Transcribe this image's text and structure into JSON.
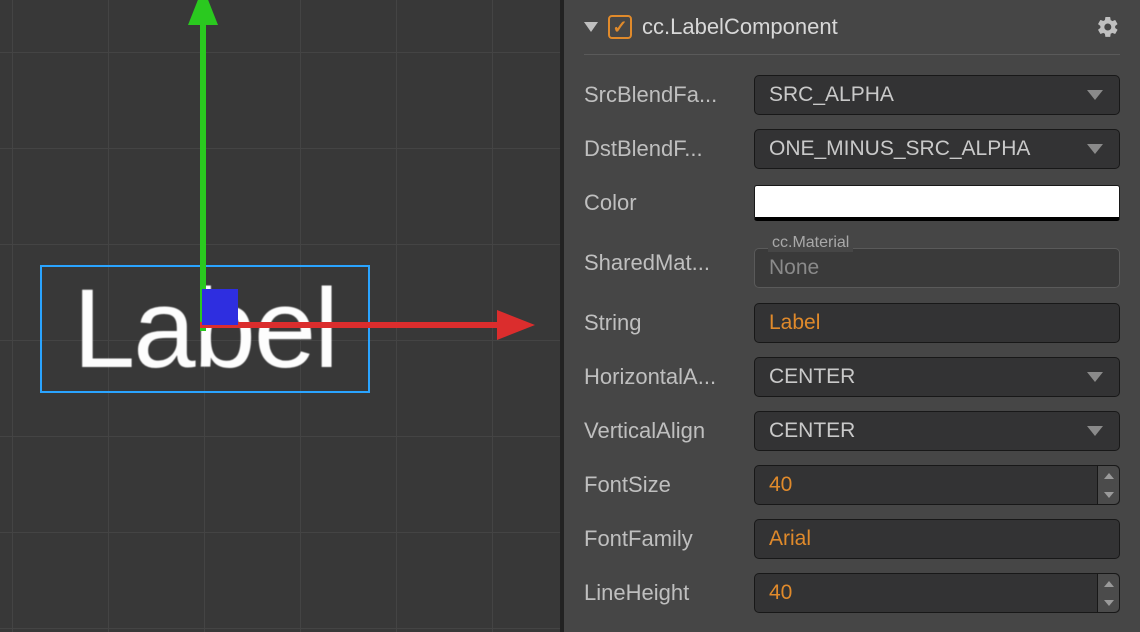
{
  "viewport": {
    "label_text": "Label"
  },
  "component": {
    "title": "cc.LabelComponent",
    "enabled": true
  },
  "props": {
    "srcBlendFactor": {
      "label": "SrcBlendFa...",
      "value": "SRC_ALPHA"
    },
    "dstBlendFactor": {
      "label": "DstBlendF...",
      "value": "ONE_MINUS_SRC_ALPHA"
    },
    "color": {
      "label": "Color",
      "value": "#FFFFFF"
    },
    "sharedMaterial": {
      "label": "SharedMat...",
      "legend": "cc.Material",
      "value": "None"
    },
    "string": {
      "label": "String",
      "value": "Label"
    },
    "horizontalAlign": {
      "label": "HorizontalA...",
      "value": "CENTER"
    },
    "verticalAlign": {
      "label": "VerticalAlign",
      "value": "CENTER"
    },
    "fontSize": {
      "label": "FontSize",
      "value": "40"
    },
    "fontFamily": {
      "label": "FontFamily",
      "value": "Arial"
    },
    "lineHeight": {
      "label": "LineHeight",
      "value": "40"
    }
  }
}
